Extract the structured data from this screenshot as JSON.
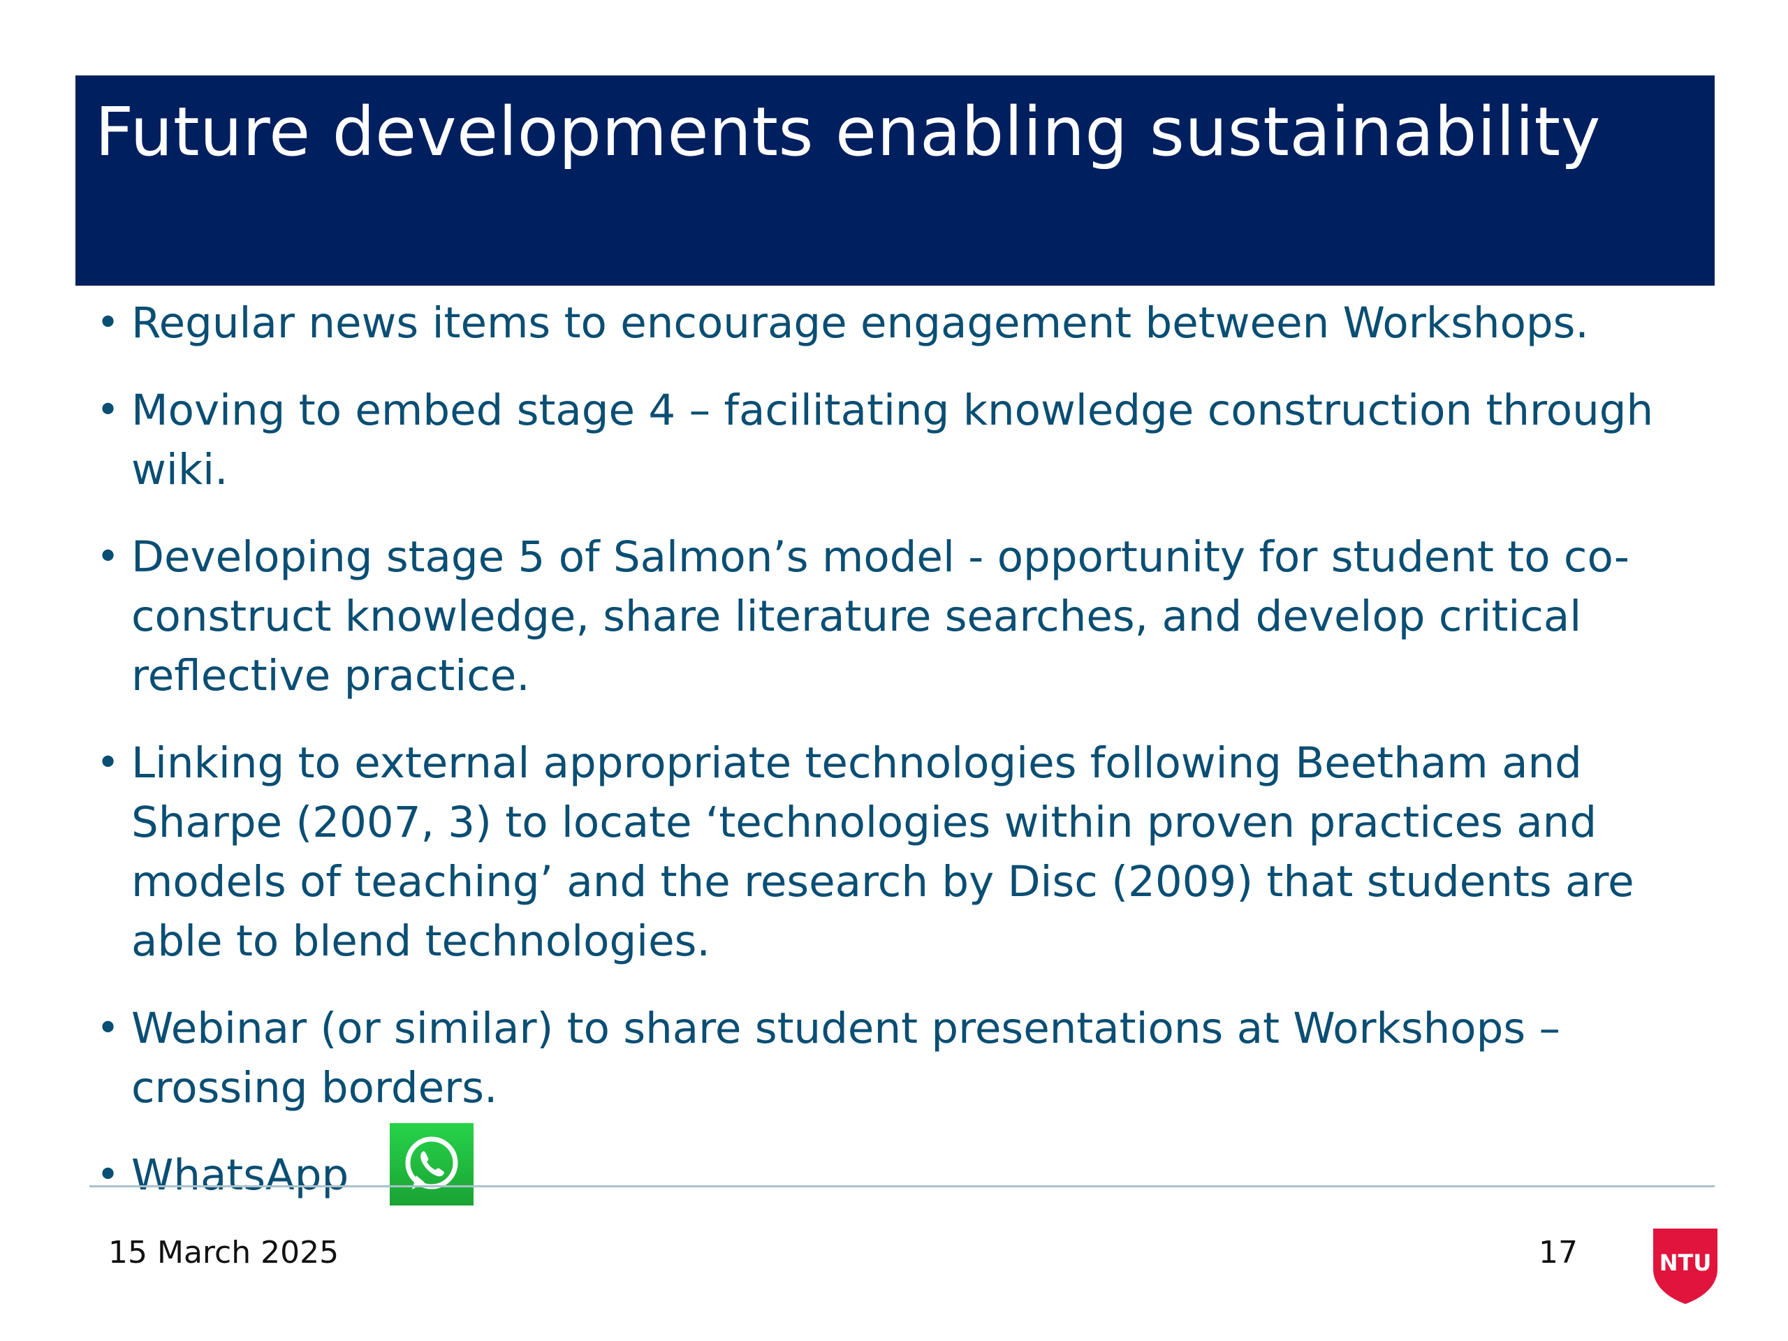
{
  "slide": {
    "title": "Future developments enabling sustainability",
    "bullet_symbol": "•",
    "bullets": [
      "Regular news items to encourage engagement between Workshops.",
      "Moving to embed stage 4 – facilitating knowledge construction through wiki.",
      "Developing stage 5 of Salmon’s model - opportunity for student to co-construct knowledge, share literature searches, and develop critical reflective practice.",
      "Linking to external appropriate technologies following  Beetham and Sharpe (2007, 3) to locate ‘technologies within proven practices and models of teaching’ and the research by Disc (2009) that students are able to blend technologies.",
      "Webinar (or similar) to share student presentations at Workshops – crossing borders.",
      "WhatsApp"
    ]
  },
  "footer": {
    "date": "15 March 2025",
    "page_number": "17",
    "logo_text": "NTU"
  },
  "icons": {
    "whatsapp": "whatsapp-icon",
    "logo": "ntu-logo"
  },
  "colors": {
    "title_background": "#001f5f",
    "title_text": "#ffffff",
    "body_text": "#0a4e73",
    "divider": "#a9c2cc",
    "whatsapp_green": "#25d366",
    "ntu_red": "#e0143c"
  }
}
